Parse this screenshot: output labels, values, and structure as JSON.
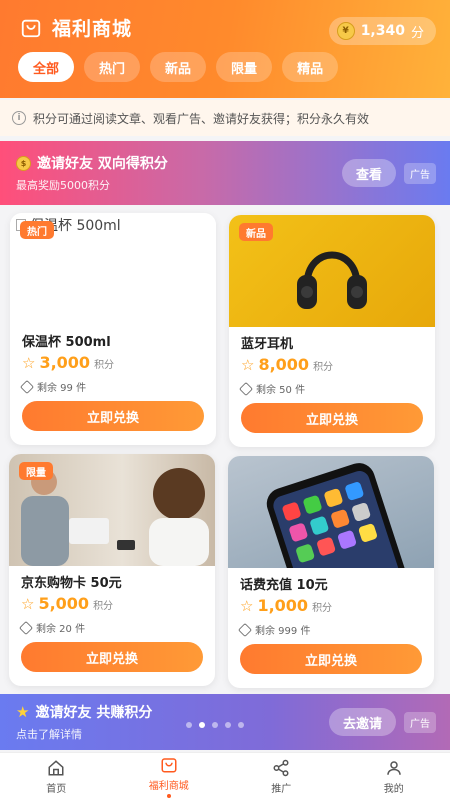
{
  "header": {
    "title": "福利商城",
    "points_value": "1,340",
    "points_unit": "分",
    "bg_color": "#ff7a2f"
  },
  "tabs": [
    {
      "label": "全部",
      "active": true
    },
    {
      "label": "热门",
      "active": false
    },
    {
      "label": "新品",
      "active": false
    },
    {
      "label": "限量",
      "active": false
    },
    {
      "label": "精品",
      "active": false
    }
  ],
  "notice": {
    "icon": "info-icon",
    "text": "积分可通过阅读文章、观看广告、邀请好友获得；积分永久有效"
  },
  "banner_top": {
    "title": "邀请好友 双向得积分",
    "subtitle": "最高奖励5000积分",
    "button": "查看",
    "ad_tag": "广告"
  },
  "products": [
    {
      "name": "保温杯 500ml",
      "tag": "热门",
      "price": "3,000",
      "unit": "积分",
      "stock": "剩余 99 件",
      "button": "立即兑换",
      "image_alt": "保温杯 500ml"
    },
    {
      "name": "蓝牙耳机",
      "tag": "新品",
      "price": "8,000",
      "unit": "积分",
      "stock": "剩余 50 件",
      "button": "立即兑换"
    },
    {
      "name": "京东购物卡 50元",
      "tag": "限量",
      "price": "5,000",
      "unit": "积分",
      "stock": "剩余 20 件",
      "button": "立即兑换"
    },
    {
      "name": "话费充值 10元",
      "tag": "",
      "price": "1,000",
      "unit": "积分",
      "stock": "剩余 999 件",
      "button": "立即兑换"
    }
  ],
  "banner_bottom": {
    "title": "邀请好友 共赚积分",
    "subtitle": "点击了解详情",
    "button": "去邀请",
    "ad_tag": "广告",
    "active_dot": 1
  },
  "bottom_nav": [
    {
      "label": "首页",
      "icon": "home-icon",
      "active": false
    },
    {
      "label": "福利商城",
      "icon": "shop-bag-icon",
      "active": true
    },
    {
      "label": "推广",
      "icon": "share-icon",
      "active": false
    },
    {
      "label": "我的",
      "icon": "user-icon",
      "active": false
    }
  ]
}
